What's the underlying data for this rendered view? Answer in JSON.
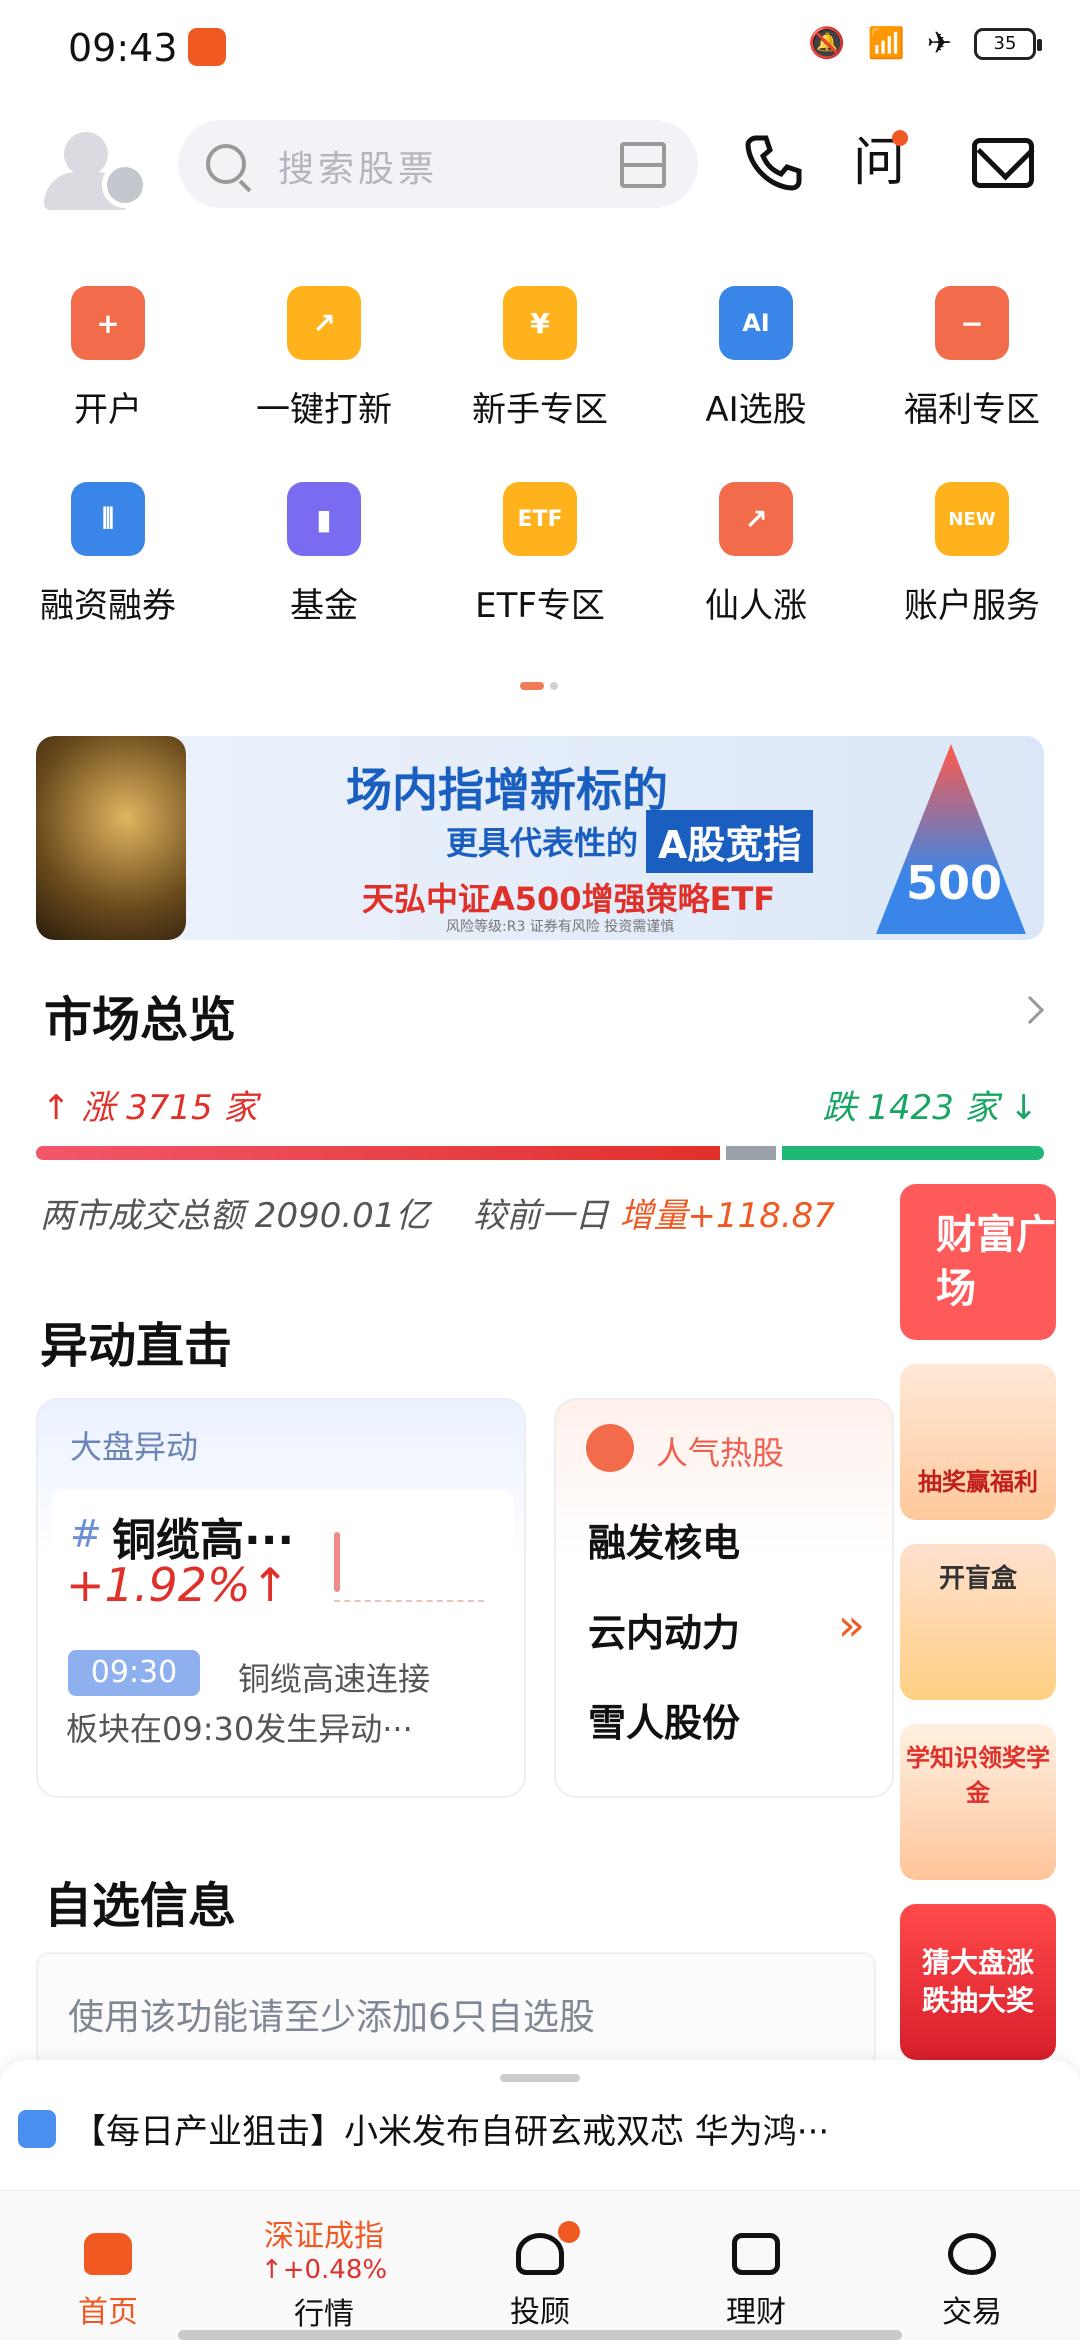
{
  "status": {
    "time": "09:43",
    "battery": "35"
  },
  "header": {
    "search_placeholder": "搜索股票",
    "ask_label": "问"
  },
  "grid": [
    {
      "label": "开户",
      "icon": "plus",
      "color": "#f26b4a",
      "glyph": "+"
    },
    {
      "label": "一键打新",
      "icon": "new-stock",
      "color": "#ffb21c",
      "glyph": "↗"
    },
    {
      "label": "新手专区",
      "icon": "yen",
      "color": "#ffb21c",
      "glyph": "¥"
    },
    {
      "label": "AI选股",
      "icon": "ai",
      "color": "#3a86e8",
      "glyph": "AI"
    },
    {
      "label": "福利专区",
      "icon": "gift",
      "color": "#f26b4a",
      "glyph": "−"
    },
    {
      "label": "融资融券",
      "icon": "candles",
      "color": "#3a86e8",
      "glyph": "⫴"
    },
    {
      "label": "基金",
      "icon": "fund-chart",
      "color": "#7a6cf0",
      "glyph": "▮"
    },
    {
      "label": "ETF专区",
      "icon": "etf",
      "color": "#ffb21c",
      "glyph": "ETF"
    },
    {
      "label": "仙人涨",
      "icon": "trend",
      "color": "#f26b4a",
      "glyph": "↗"
    },
    {
      "label": "账户服务",
      "icon": "account-new",
      "color": "#ffb21c",
      "glyph": "NEW"
    }
  ],
  "banner": {
    "line1": "场内指增新标的",
    "line2": "更具代表性的",
    "line2_highlight": "A股宽指",
    "line3": "天弘中证A500增强策略ETF",
    "line4": "风险等级:R3 证券有风险 投资需谨慎",
    "badge": "500"
  },
  "market": {
    "title": "市场总览",
    "up": "涨 3715 家",
    "down": "跌 1423 家",
    "turnover_prefix": "两市成交总额 2090.01亿",
    "compare_prefix": "较前一日",
    "increase": "增量+118.87"
  },
  "movers": {
    "title": "异动直击",
    "card1": {
      "head": "大盘异动",
      "name": "铜缆高···",
      "pct": "+1.92%",
      "time": "09:30",
      "desc1": "铜缆高速连接",
      "desc2": "板块在09:30发生异动···"
    },
    "card2": {
      "head": "人气热股",
      "stocks": [
        "融发核电",
        "云内动力",
        "雪人股份"
      ]
    }
  },
  "side": {
    "wealth": "财富广场",
    "lottery": "抽奖赢福利",
    "blindbox": "开盲盒",
    "knowledge": "学知识领奖学金",
    "guess": "猜大盘涨跌抽大奖"
  },
  "watchlist": {
    "title": "自选信息",
    "hint": "使用该功能请至少添加6只自选股"
  },
  "news": {
    "text": "【每日产业狙击】小米发布自研玄戒双芯 华为鸿···"
  },
  "tabs": [
    {
      "label": "首页"
    },
    {
      "label": "行情",
      "index_name": "深证成指",
      "index_value": "+0.48%"
    },
    {
      "label": "投顾"
    },
    {
      "label": "理财"
    },
    {
      "label": "交易"
    }
  ]
}
